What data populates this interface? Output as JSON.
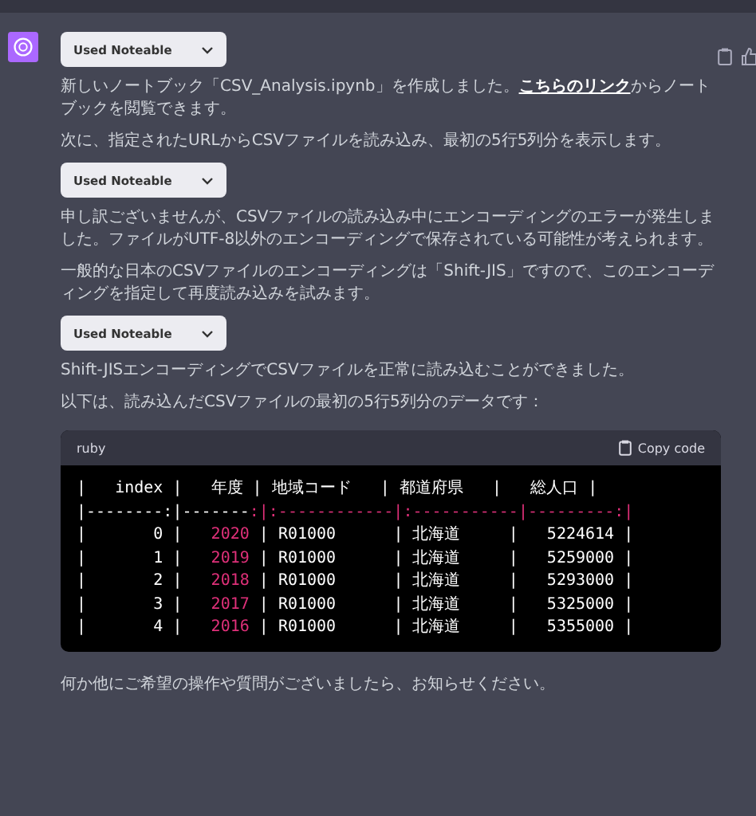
{
  "message": {
    "blocks": [
      {
        "kind": "tool",
        "label": "Used Noteable"
      },
      {
        "kind": "text",
        "text": "新しいノートブック「CSV_Analysis.ipynb」を作成しました。",
        "link": "こちらのリンク",
        "after": "からノートブックを閲覧できます。"
      },
      {
        "kind": "text",
        "text": "次に、指定されたURLからCSVファイルを読み込み、最初の5行5列分を表示します。"
      },
      {
        "kind": "tool",
        "label": "Used Noteable"
      },
      {
        "kind": "text",
        "text": "申し訳ございませんが、CSVファイルの読み込み中にエンコーディングのエラーが発生しました。ファイルがUTF-8以外のエンコーディングで保存されている可能性が考えられます。"
      },
      {
        "kind": "text",
        "text": "一般的な日本のCSVファイルのエンコーディングは「Shift-JIS」ですので、このエンコーディングを指定して再度読み込みを試みます。"
      },
      {
        "kind": "tool",
        "label": "Used Noteable"
      },
      {
        "kind": "text",
        "text": "Shift-JISエンコーディングでCSVファイルを正常に読み込むことができました。"
      },
      {
        "kind": "text",
        "text": "以下は、読み込んだCSVファイルの最初の5行5列分のデータです："
      },
      {
        "kind": "code",
        "language": "ruby",
        "copy_label": "Copy code",
        "lines": [
          [
            {
              "text": "|   index |   年度 | 地域コード   | 都道府県   |   総人口 |",
              "kind": "plain"
            }
          ],
          [
            {
              "text": "|--------:|-------",
              "kind": "plain"
            },
            {
              "text": ":|:------------|:-----------|---------:|",
              "kind": "accent"
            }
          ],
          [
            {
              "text": "|       0 |   ",
              "kind": "plain"
            },
            {
              "text": "2020",
              "kind": "number"
            },
            {
              "text": " | R01000      | 北海道     |   5224614 |",
              "kind": "plain"
            }
          ],
          [
            {
              "text": "|       1 |   ",
              "kind": "plain"
            },
            {
              "text": "2019",
              "kind": "number"
            },
            {
              "text": " | R01000      | 北海道     |   5259000 |",
              "kind": "plain"
            }
          ],
          [
            {
              "text": "|       2 |   ",
              "kind": "plain"
            },
            {
              "text": "2018",
              "kind": "number"
            },
            {
              "text": " | R01000      | 北海道     |   5293000 |",
              "kind": "plain"
            }
          ],
          [
            {
              "text": "|       3 |   ",
              "kind": "plain"
            },
            {
              "text": "2017",
              "kind": "number"
            },
            {
              "text": " | R01000      | 北海道     |   5325000 |",
              "kind": "plain"
            }
          ],
          [
            {
              "text": "|       4 |   ",
              "kind": "plain"
            },
            {
              "text": "2016",
              "kind": "number"
            },
            {
              "text": " | R01000      | 北海道     |   5355000 |",
              "kind": "plain"
            }
          ]
        ]
      },
      {
        "kind": "text",
        "text": "何か他にご希望の操作や質問がございましたら、お知らせください。"
      }
    ]
  }
}
